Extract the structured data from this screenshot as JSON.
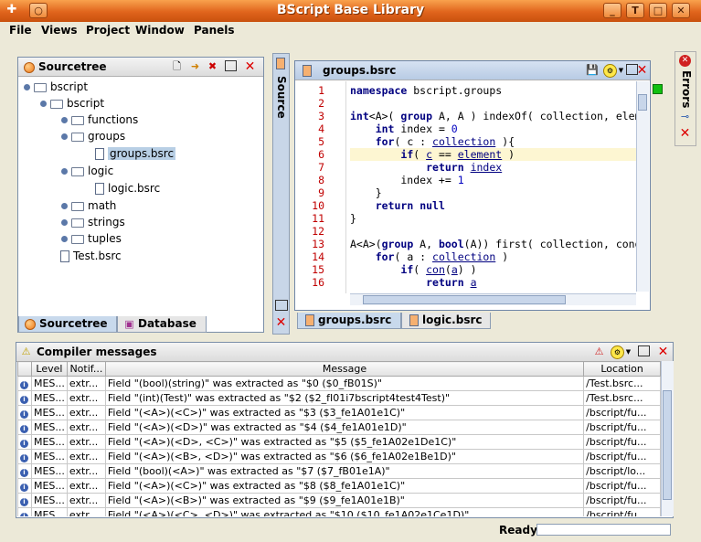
{
  "window": {
    "title": "BScript Base Library"
  },
  "menu": [
    "File",
    "Views",
    "Project",
    "Window",
    "Panels"
  ],
  "sourcetree": {
    "title": "Sourcetree",
    "items": [
      {
        "label": "bscript"
      },
      {
        "label": "bscript"
      },
      {
        "label": "functions"
      },
      {
        "label": "groups"
      },
      {
        "label": "groups.bsrc"
      },
      {
        "label": "logic"
      },
      {
        "label": "logic.bsrc"
      },
      {
        "label": "math"
      },
      {
        "label": "strings"
      },
      {
        "label": "tuples"
      },
      {
        "label": "Test.bsrc"
      }
    ],
    "tabs": [
      "Sourcetree",
      "Database"
    ]
  },
  "side_source_label": "Source",
  "side_errors_label": "Errors",
  "editor": {
    "title": "groups.bsrc",
    "lines": [
      "1",
      "2",
      "3",
      "4",
      "5",
      "6",
      "7",
      "8",
      "9",
      "10",
      "11",
      "12",
      "13",
      "14",
      "15",
      "16"
    ],
    "tabs": [
      "groups.bsrc",
      "logic.bsrc"
    ]
  },
  "compiler": {
    "title": "Compiler messages",
    "columns": [
      "",
      "Level",
      "Notif...",
      "Message",
      "Location"
    ],
    "rows": [
      {
        "level": "MES...",
        "notif": "extr...",
        "message": "Field \"(bool)(string)\" was extracted as \"$0 ($0_fB01S)\"",
        "location": "/Test.bsrc..."
      },
      {
        "level": "MES...",
        "notif": "extr...",
        "message": "Field \"(int)(Test)\" was extracted as \"$2 ($2_fI01i7bscript4test4Test)\"",
        "location": "/Test.bsrc..."
      },
      {
        "level": "MES...",
        "notif": "extr...",
        "message": "Field \"(<A>)(<C>)\" was extracted as \"$3 ($3_fe1A01e1C)\"",
        "location": "/bscript/fu..."
      },
      {
        "level": "MES...",
        "notif": "extr...",
        "message": "Field \"(<A>)(<D>)\" was extracted as \"$4 ($4_fe1A01e1D)\"",
        "location": "/bscript/fu..."
      },
      {
        "level": "MES...",
        "notif": "extr...",
        "message": "Field \"(<A>)(<D>, <C>)\" was extracted as \"$5 ($5_fe1A02e1De1C)\"",
        "location": "/bscript/fu..."
      },
      {
        "level": "MES...",
        "notif": "extr...",
        "message": "Field \"(<A>)(<B>, <D>)\" was extracted as \"$6 ($6_fe1A02e1Be1D)\"",
        "location": "/bscript/fu..."
      },
      {
        "level": "MES...",
        "notif": "extr...",
        "message": "Field \"(bool)(<A>)\" was extracted as \"$7 ($7_fB01e1A)\"",
        "location": "/bscript/lo..."
      },
      {
        "level": "MES...",
        "notif": "extr...",
        "message": "Field \"(<A>)(<C>)\" was extracted as \"$8 ($8_fe1A01e1C)\"",
        "location": "/bscript/fu..."
      },
      {
        "level": "MES...",
        "notif": "extr...",
        "message": "Field \"(<A>)(<B>)\" was extracted as \"$9 ($9_fe1A01e1B)\"",
        "location": "/bscript/fu..."
      },
      {
        "level": "MES...",
        "notif": "extr...",
        "message": "Field \"(<A>)(<C>, <D>)\" was extracted as \"$10 ($10_fe1A02e1Ce1D)\"",
        "location": "/bscript/fu..."
      }
    ]
  },
  "status": {
    "text": "Ready"
  }
}
